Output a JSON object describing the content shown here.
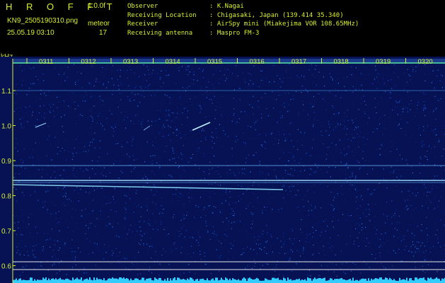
{
  "header": {
    "title": "H R O F F T",
    "version": "1.0.0f",
    "filename": "KN9_2505190310.png",
    "mode": "meteor",
    "datetime": "25.05.19 03:10",
    "count": "17",
    "info": [
      {
        "key": "Observer",
        "value": ": K.Nagai"
      },
      {
        "key": "Receiving Location",
        "value": ": Chigasaki, Japan (139.414 35.340)"
      },
      {
        "key": "Receiver",
        "value": ": AirSpy mini (Miakejima VOR 108.65MHz)"
      },
      {
        "key": "Receiving antenna",
        "value": ": Maspro FM-3"
      }
    ]
  },
  "axis": {
    "unit": "kHz",
    "ticks": [
      "1.1",
      "1.0",
      "0.9",
      "0.8",
      "0.7",
      "0.6"
    ],
    "time_labels": [
      "0311",
      "0312",
      "0313",
      "0314",
      "0315",
      "0316",
      "0317",
      "0318",
      "0319",
      "0320"
    ]
  },
  "colors": {
    "text": "#d8ef2e",
    "background": "#061254",
    "signal": "#8fd8ff",
    "baseline": "#33ccff"
  }
}
